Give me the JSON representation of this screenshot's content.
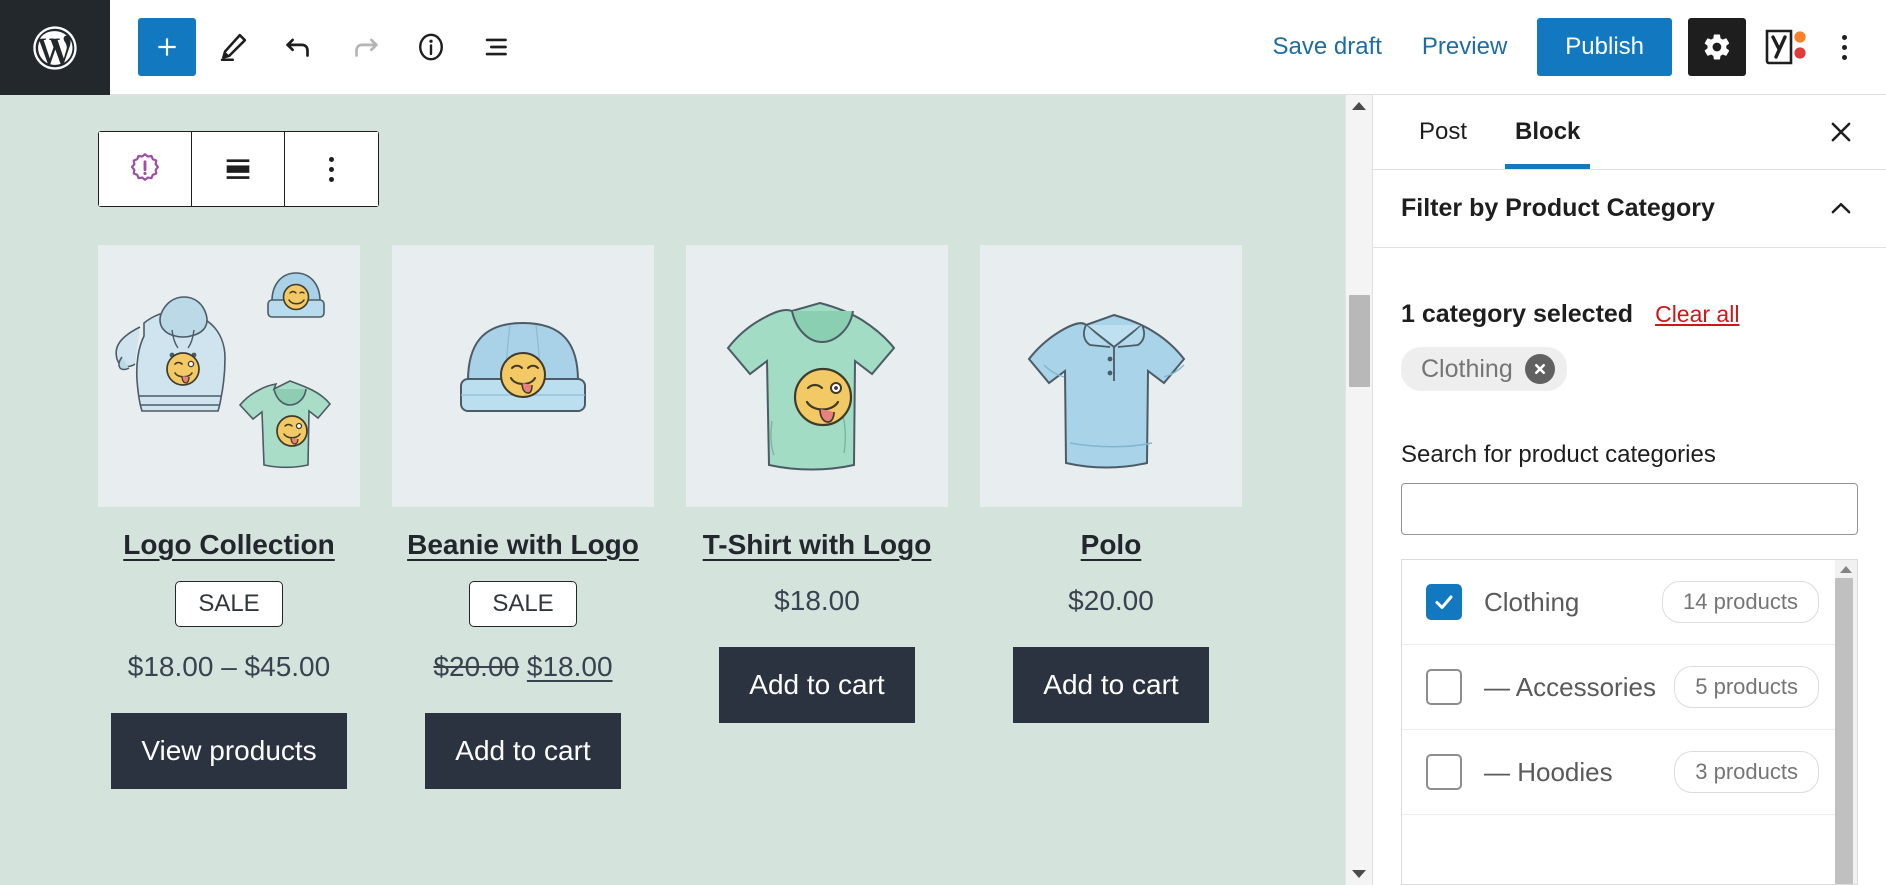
{
  "topbar": {
    "logo_icon": "wordpress-logo-icon",
    "tools": [
      {
        "name": "add-block-button",
        "icon": "plus-icon",
        "label": "Add block"
      },
      {
        "name": "tools-button",
        "icon": "pencil-icon",
        "label": "Tools"
      },
      {
        "name": "undo-button",
        "icon": "undo-arrow-icon",
        "label": "Undo"
      },
      {
        "name": "redo-button",
        "icon": "redo-arrow-icon",
        "label": "Redo"
      },
      {
        "name": "details-button",
        "icon": "info-circle-icon",
        "label": "Details"
      },
      {
        "name": "list-view-button",
        "icon": "list-view-icon",
        "label": "List view"
      }
    ],
    "save_draft_label": "Save draft",
    "preview_label": "Preview",
    "publish_label": "Publish",
    "settings_icon": "gear-icon",
    "yoast_icon": "yoast-seo-icon",
    "more_icon": "vertical-dots-icon",
    "accent_blue": "#1279c0",
    "dark": "#1e1e1e"
  },
  "block_toolbar": {
    "items": [
      {
        "name": "block-type-button",
        "icon": "sale-starburst-icon"
      },
      {
        "name": "align-button",
        "icon": "align-wide-icon"
      },
      {
        "name": "block-options-button",
        "icon": "vertical-dots-icon"
      }
    ]
  },
  "editor": {
    "background": "#d4e4dc",
    "products": [
      {
        "title": "Logo Collection",
        "image_alt": "hoodie-beanie-tshirt-collection",
        "badge": "SALE",
        "price": "$18.00 – $45.00",
        "price_old": "",
        "price_new": "",
        "cta": "View products"
      },
      {
        "title": "Beanie with Logo",
        "image_alt": "blue-beanie",
        "badge": "SALE",
        "price": "",
        "price_old": "$20.00",
        "price_new": "$18.00",
        "cta": "Add to cart"
      },
      {
        "title": "T-Shirt with Logo",
        "image_alt": "green-v-neck-tshirt",
        "badge": "",
        "price": "$18.00",
        "price_old": "",
        "price_new": "",
        "cta": "Add to cart"
      },
      {
        "title": "Polo",
        "image_alt": "blue-polo-shirt",
        "badge": "",
        "price": "$20.00",
        "price_old": "",
        "price_new": "",
        "cta": "Add to cart"
      }
    ]
  },
  "sidebar": {
    "tabs": [
      {
        "label": "Post",
        "active": false
      },
      {
        "label": "Block",
        "active": true
      }
    ],
    "close_icon": "close-x-icon",
    "panel": {
      "title": "Filter by Product Category",
      "collapse_icon": "chevron-up-icon",
      "selected_text": "1 category selected",
      "clear_all_label": "Clear all",
      "chips": [
        {
          "label": "Clothing",
          "remove_icon": "chip-remove-x-icon"
        }
      ],
      "search_label": "Search for product categories",
      "search_value": "",
      "search_placeholder": "",
      "categories": [
        {
          "name": "Clothing",
          "count": "14 products",
          "checked": true,
          "indent": false
        },
        {
          "name": "— Accessories",
          "count": "5 products",
          "checked": false,
          "indent": true
        },
        {
          "name": "— Hoodies",
          "count": "3 products",
          "checked": false,
          "indent": true
        }
      ]
    }
  }
}
